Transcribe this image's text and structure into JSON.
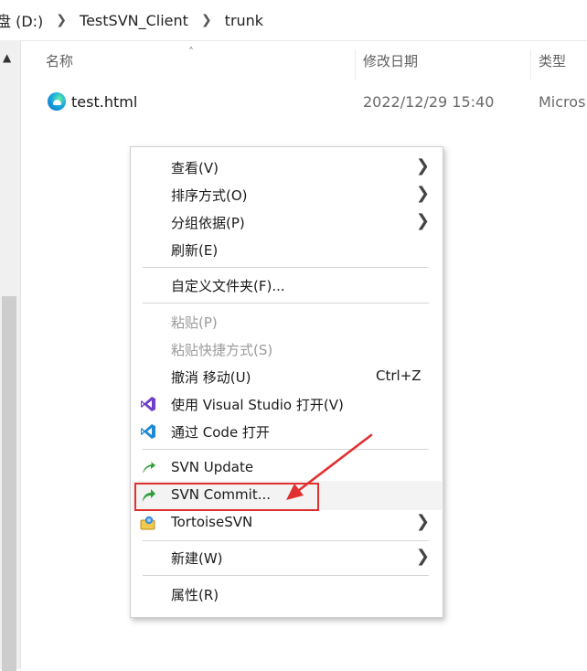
{
  "breadcrumb": {
    "drive": "盘 (D:)",
    "folder": "TestSVN_Client",
    "current": "trunk"
  },
  "columns": {
    "name": "名称",
    "modified": "修改日期",
    "type": "类型"
  },
  "file": {
    "name": "test.html",
    "modified": "2022/12/29 15:40",
    "type": "Micros",
    "icon": "edge-file-icon"
  },
  "menu": {
    "view": "查看(V)",
    "sort": "排序方式(O)",
    "group": "分组依据(P)",
    "refresh": "刷新(E)",
    "customize": "自定义文件夹(F)...",
    "paste": "粘贴(P)",
    "paste_shortcut": "粘贴快捷方式(S)",
    "undo_move": "撤消 移动(U)",
    "undo_shortcut": "Ctrl+Z",
    "open_vs": "使用 Visual Studio 打开(V)",
    "open_code": "通过 Code 打开",
    "svn_update": "SVN Update",
    "svn_commit": "SVN Commit...",
    "tortoise": "TortoiseSVN",
    "new": "新建(W)",
    "properties": "属性(R)"
  },
  "colors": {
    "highlight_border": "#e03030",
    "svn_update_green": "#2e9e3a",
    "vs_purple": "#6e3fc9",
    "vscode_blue": "#1f8ad2"
  }
}
